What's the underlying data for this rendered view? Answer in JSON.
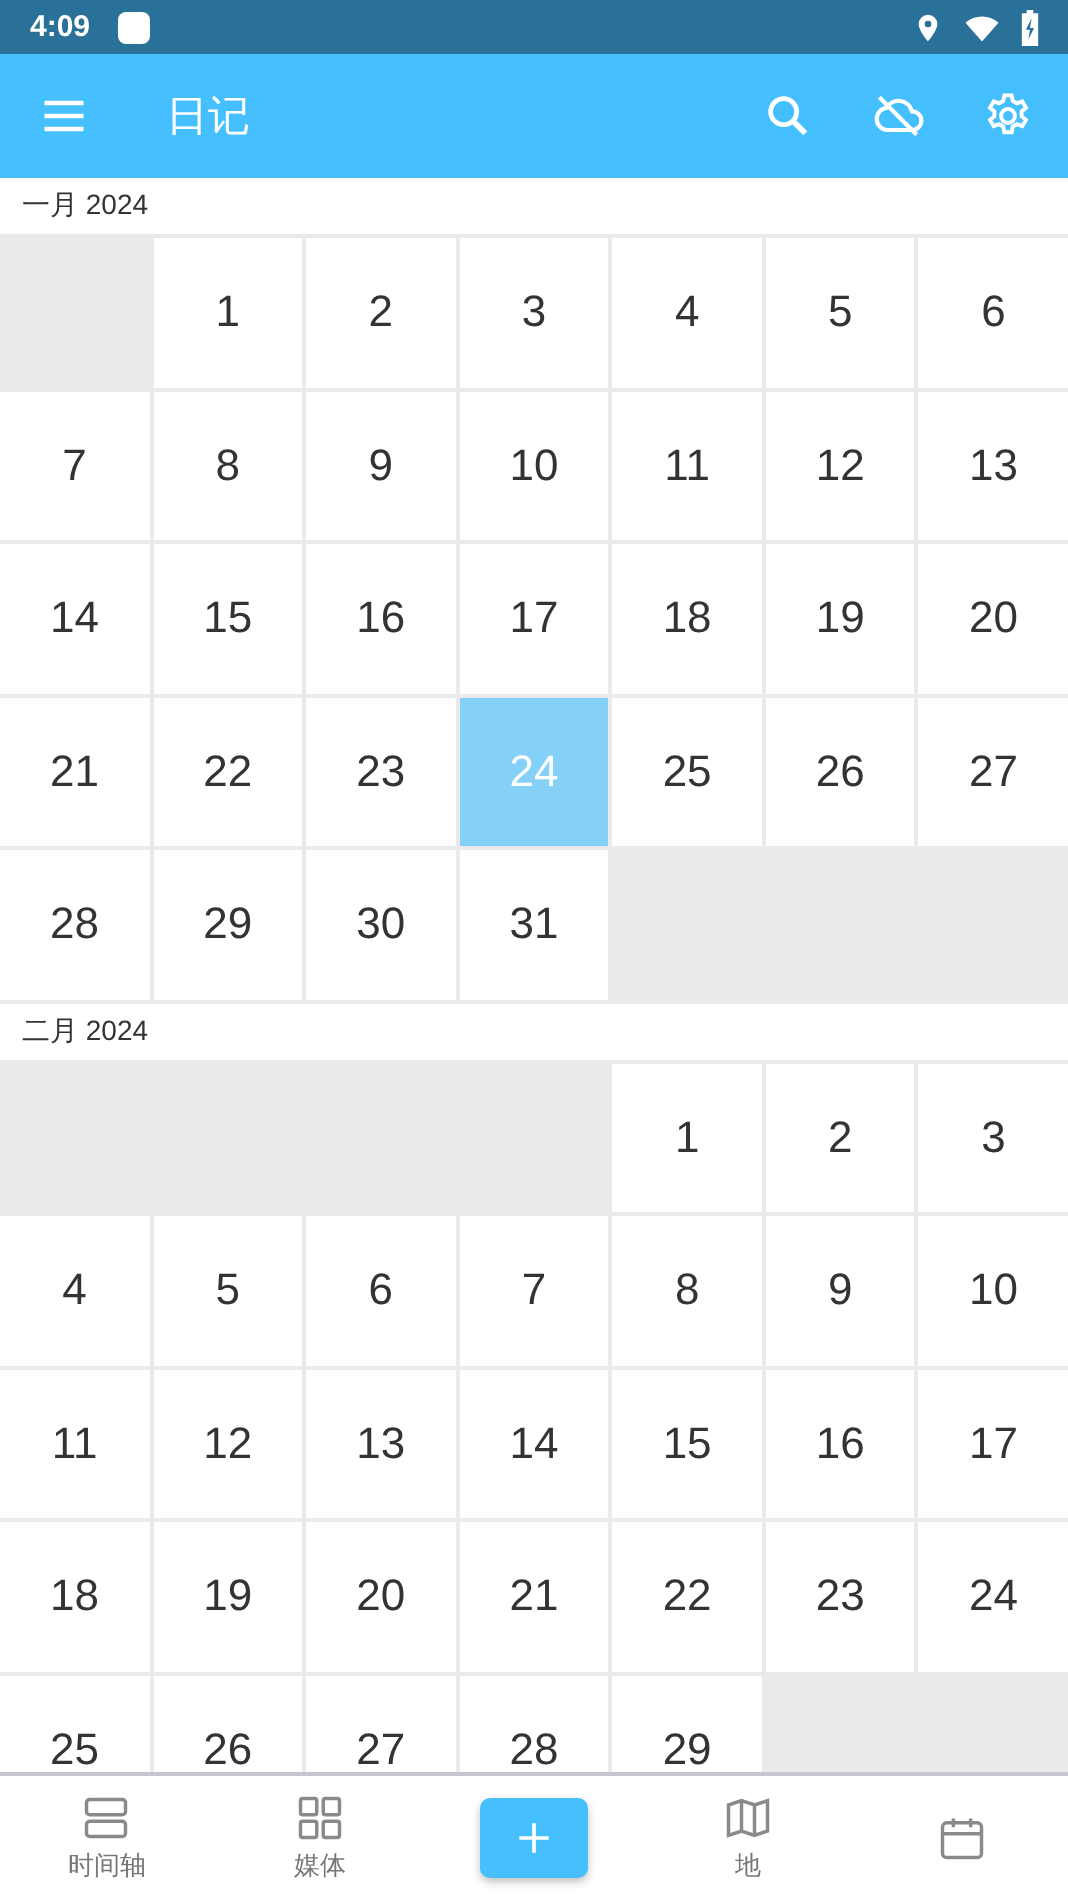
{
  "status_bar": {
    "time": "4:09"
  },
  "app_bar": {
    "title": "日记"
  },
  "months": [
    {
      "label": "一月 2024",
      "cells": [
        {
          "kind": "blank"
        },
        {
          "kind": "day",
          "day": "1",
          "selected": false
        },
        {
          "kind": "day",
          "day": "2",
          "selected": false
        },
        {
          "kind": "day",
          "day": "3",
          "selected": false
        },
        {
          "kind": "day",
          "day": "4",
          "selected": false
        },
        {
          "kind": "day",
          "day": "5",
          "selected": false
        },
        {
          "kind": "day",
          "day": "6",
          "selected": false
        },
        {
          "kind": "day",
          "day": "7",
          "selected": false
        },
        {
          "kind": "day",
          "day": "8",
          "selected": false
        },
        {
          "kind": "day",
          "day": "9",
          "selected": false
        },
        {
          "kind": "day",
          "day": "10",
          "selected": false
        },
        {
          "kind": "day",
          "day": "11",
          "selected": false
        },
        {
          "kind": "day",
          "day": "12",
          "selected": false
        },
        {
          "kind": "day",
          "day": "13",
          "selected": false
        },
        {
          "kind": "day",
          "day": "14",
          "selected": false
        },
        {
          "kind": "day",
          "day": "15",
          "selected": false
        },
        {
          "kind": "day",
          "day": "16",
          "selected": false
        },
        {
          "kind": "day",
          "day": "17",
          "selected": false
        },
        {
          "kind": "day",
          "day": "18",
          "selected": false
        },
        {
          "kind": "day",
          "day": "19",
          "selected": false
        },
        {
          "kind": "day",
          "day": "20",
          "selected": false
        },
        {
          "kind": "day",
          "day": "21",
          "selected": false
        },
        {
          "kind": "day",
          "day": "22",
          "selected": false
        },
        {
          "kind": "day",
          "day": "23",
          "selected": false
        },
        {
          "kind": "day",
          "day": "24",
          "selected": true
        },
        {
          "kind": "day",
          "day": "25",
          "selected": false
        },
        {
          "kind": "day",
          "day": "26",
          "selected": false
        },
        {
          "kind": "day",
          "day": "27",
          "selected": false
        },
        {
          "kind": "day",
          "day": "28",
          "selected": false
        },
        {
          "kind": "day",
          "day": "29",
          "selected": false
        },
        {
          "kind": "day",
          "day": "30",
          "selected": false
        },
        {
          "kind": "day",
          "day": "31",
          "selected": false
        },
        {
          "kind": "blank"
        },
        {
          "kind": "blank"
        },
        {
          "kind": "blank"
        }
      ]
    },
    {
      "label": "二月 2024",
      "cells": [
        {
          "kind": "blank"
        },
        {
          "kind": "blank"
        },
        {
          "kind": "blank"
        },
        {
          "kind": "blank"
        },
        {
          "kind": "day",
          "day": "1",
          "selected": false
        },
        {
          "kind": "day",
          "day": "2",
          "selected": false
        },
        {
          "kind": "day",
          "day": "3",
          "selected": false
        },
        {
          "kind": "day",
          "day": "4",
          "selected": false
        },
        {
          "kind": "day",
          "day": "5",
          "selected": false
        },
        {
          "kind": "day",
          "day": "6",
          "selected": false
        },
        {
          "kind": "day",
          "day": "7",
          "selected": false
        },
        {
          "kind": "day",
          "day": "8",
          "selected": false
        },
        {
          "kind": "day",
          "day": "9",
          "selected": false
        },
        {
          "kind": "day",
          "day": "10",
          "selected": false
        },
        {
          "kind": "day",
          "day": "11",
          "selected": false
        },
        {
          "kind": "day",
          "day": "12",
          "selected": false
        },
        {
          "kind": "day",
          "day": "13",
          "selected": false
        },
        {
          "kind": "day",
          "day": "14",
          "selected": false
        },
        {
          "kind": "day",
          "day": "15",
          "selected": false
        },
        {
          "kind": "day",
          "day": "16",
          "selected": false
        },
        {
          "kind": "day",
          "day": "17",
          "selected": false
        },
        {
          "kind": "day",
          "day": "18",
          "selected": false
        },
        {
          "kind": "day",
          "day": "19",
          "selected": false
        },
        {
          "kind": "day",
          "day": "20",
          "selected": false
        },
        {
          "kind": "day",
          "day": "21",
          "selected": false
        },
        {
          "kind": "day",
          "day": "22",
          "selected": false
        },
        {
          "kind": "day",
          "day": "23",
          "selected": false
        },
        {
          "kind": "day",
          "day": "24",
          "selected": false
        },
        {
          "kind": "day",
          "day": "25",
          "selected": false
        },
        {
          "kind": "day",
          "day": "26",
          "selected": false
        },
        {
          "kind": "day",
          "day": "27",
          "selected": false
        },
        {
          "kind": "day",
          "day": "28",
          "selected": false
        },
        {
          "kind": "day",
          "day": "29",
          "selected": false
        },
        {
          "kind": "blank"
        },
        {
          "kind": "blank"
        }
      ]
    }
  ],
  "bottom_nav": [
    {
      "kind": "timeline",
      "label": "时间轴"
    },
    {
      "kind": "media",
      "label": "媒体"
    },
    {
      "kind": "add"
    },
    {
      "kind": "map",
      "label": "地"
    },
    {
      "kind": "calendar"
    }
  ]
}
